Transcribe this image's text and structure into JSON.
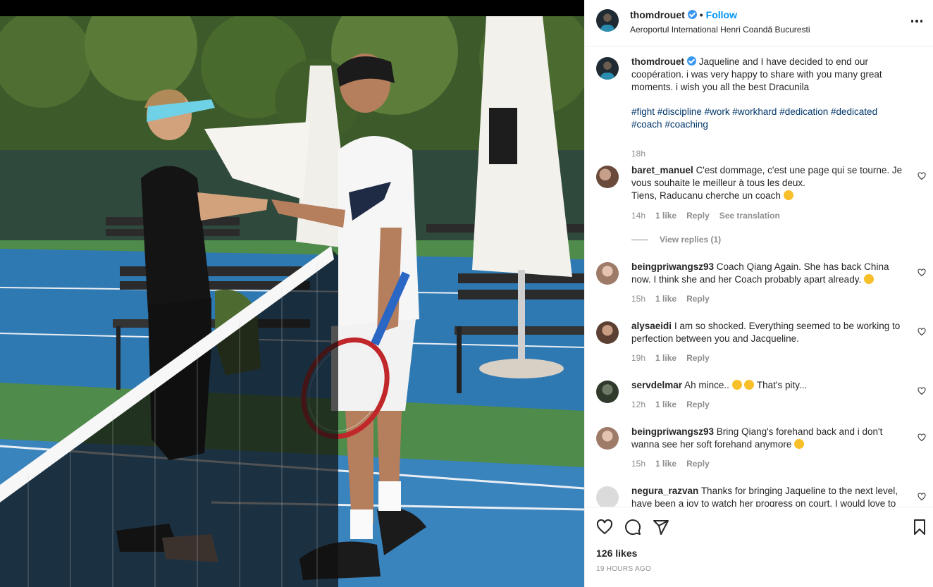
{
  "post": {
    "username": "thomdrouet",
    "follow_label": "Follow",
    "location": "Aeroportul International Henri Coandă Bucuresti",
    "caption": "Jaqueline and I have decided to end our coopération. i was very happy to share with you many great moments. i wish you all the best Dracunila",
    "hashtags": [
      "#fight",
      "#discipline",
      "#work",
      "#workhard",
      "#dedication",
      "#dedicated",
      "#coach",
      "#coaching"
    ],
    "caption_time": "18h",
    "likes": "126 likes",
    "posted": "19 HOURS AGO"
  },
  "comments": [
    {
      "user": "baret_manuel",
      "text_1": "C'est dommage, c'est une page qui se tourne. Je vous souhaite le meilleur à tous les deux.",
      "text_2": "Tiens, Raducanu cherche un coach",
      "time": "14h",
      "likes": "1 like",
      "reply": "Reply",
      "translate": "See translation",
      "view_replies": "View replies (1)"
    },
    {
      "user": "beingpriwangsz93",
      "text": "Coach Qiang Again. She has back China now. I think she and her Coach probably apart already.",
      "time": "15h",
      "likes": "1 like",
      "reply": "Reply"
    },
    {
      "user": "alysaeidi",
      "text": "I am so shocked. Everything seemed to be working to perfection between you and Jacqueline.",
      "time": "19h",
      "likes": "1 like",
      "reply": "Reply"
    },
    {
      "user": "servdelmar",
      "text": "Ah mince..",
      "text_after": "That's pity...",
      "time": "12h",
      "likes": "1 like",
      "reply": "Reply"
    },
    {
      "user": "beingpriwangsz93",
      "text": "Bring Qiang's forehand back and i don't wanna see her soft forehand anymore",
      "time": "15h",
      "likes": "1 like",
      "reply": "Reply"
    },
    {
      "user": "negura_razvan",
      "text": "Thanks for bringing Jaqueline to the next level, have been a joy to watch her progress on court. I would love to"
    }
  ],
  "colors": {
    "link": "#00376b",
    "follow": "#0095f6",
    "muted": "#8e8e8e",
    "court_blue": "#2f79b3",
    "court_green": "#4f8b4a"
  },
  "icons": [
    "heart-icon",
    "comment-icon",
    "share-icon",
    "bookmark-icon",
    "more-options-icon",
    "verified-badge-icon"
  ]
}
